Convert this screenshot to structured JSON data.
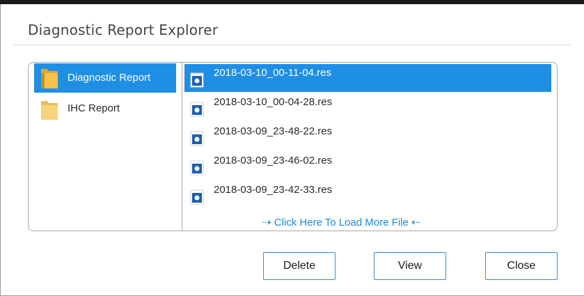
{
  "dialog": {
    "title": "Diagnostic Report Explorer"
  },
  "folders": [
    {
      "label": "Diagnostic Report",
      "selected": true,
      "icon": "folder-icon"
    },
    {
      "label": "IHC Report",
      "selected": false,
      "icon": "folder-icon"
    }
  ],
  "files": [
    {
      "name": "2018-03-10_00-11-04.res",
      "selected": true,
      "icon": "file-icon"
    },
    {
      "name": "2018-03-10_00-04-28.res",
      "selected": false,
      "icon": "file-icon"
    },
    {
      "name": "2018-03-09_23-48-22.res",
      "selected": false,
      "icon": "file-icon"
    },
    {
      "name": "2018-03-09_23-46-02.res",
      "selected": false,
      "icon": "file-icon"
    },
    {
      "name": "2018-03-09_23-42-33.res",
      "selected": false,
      "icon": "file-icon"
    }
  ],
  "load_more": {
    "label": "⇢ Click Here To Load More File ⇠"
  },
  "buttons": {
    "delete": "Delete",
    "view": "View",
    "close": "Close"
  },
  "colors": {
    "selection": "#1f8fe6",
    "accent_link": "#1a8ad6",
    "button_border": "#2f8fd8"
  }
}
